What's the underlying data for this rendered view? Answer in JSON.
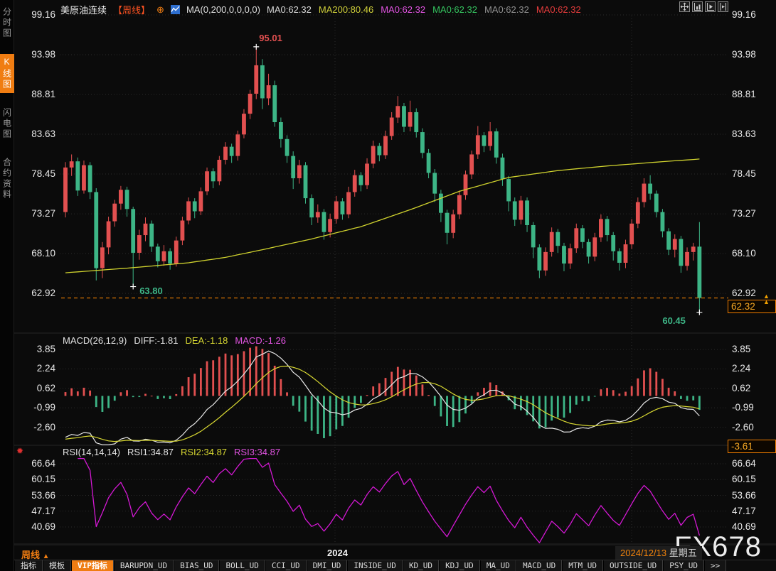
{
  "header": {
    "symbol": "美原油连续",
    "period_tag": "【周线】",
    "link_glyph": "⊕",
    "ma_settings": "MA(0,200,0,0,0,0)",
    "ma_items": [
      {
        "label": "MA0:62.32",
        "color": "#d8d8d8"
      },
      {
        "label": "MA200:80.46",
        "color": "#cfcf3a"
      },
      {
        "label": "MA0:62.32",
        "color": "#e254e2"
      },
      {
        "label": "MA0:62.32",
        "color": "#35c45f"
      },
      {
        "label": "MA0:62.32",
        "color": "#8f8f8f"
      },
      {
        "label": "MA0:62.32",
        "color": "#e23c3c"
      }
    ],
    "toolbar_icons": [
      "pan-icon",
      "axis-compress-icon",
      "axis-play-icon",
      "axis-shift-icon"
    ]
  },
  "sidebar": {
    "items": [
      {
        "label": "分时图",
        "name": "sidebar-item-time-chart",
        "active": false
      },
      {
        "label": "K线图",
        "name": "sidebar-item-kline-chart",
        "active": true
      },
      {
        "label": "闪电图",
        "name": "sidebar-item-flash-chart",
        "active": false
      },
      {
        "label": "合约资料",
        "name": "sidebar-item-contract-info",
        "active": false
      }
    ]
  },
  "macd_panel": {
    "legend": {
      "title": "MACD(26,12,9)",
      "diff": "DIFF:-1.81",
      "dea": "DEA:-1.18",
      "macd": "MACD:-1.26"
    }
  },
  "rsi_panel": {
    "legend": {
      "title": "RSI(14,14,14)",
      "rsi1": "RSI1:34.87",
      "rsi2": "RSI2:34.87",
      "rsi3": "RSI3:34.87"
    }
  },
  "timeline": {
    "period_label": "周线",
    "period_arrow": "▲",
    "year_label": "2024",
    "date": "2024/12/13",
    "weekday": "星期五",
    "watermark": "FX678"
  },
  "tabs": {
    "items": [
      {
        "label": "指标",
        "name": "tab-indicator",
        "active": false
      },
      {
        "label": "模板",
        "name": "tab-template",
        "active": false
      },
      {
        "label": "VIP指标",
        "name": "tab-vip-indicator",
        "active": true
      },
      {
        "label": "BARUPDN_UD",
        "name": "tab-barupdn-ud",
        "active": false
      },
      {
        "label": "BIAS_UD",
        "name": "tab-bias-ud",
        "active": false
      },
      {
        "label": "BOLL_UD",
        "name": "tab-boll-ud",
        "active": false
      },
      {
        "label": "CCI_UD",
        "name": "tab-cci-ud",
        "active": false
      },
      {
        "label": "DMI_UD",
        "name": "tab-dmi-ud",
        "active": false
      },
      {
        "label": "INSIDE_UD",
        "name": "tab-inside-ud",
        "active": false
      },
      {
        "label": "KD_UD",
        "name": "tab-kd-ud",
        "active": false
      },
      {
        "label": "KDJ_UD",
        "name": "tab-kdj-ud",
        "active": false
      },
      {
        "label": "MA_UD",
        "name": "tab-ma-ud",
        "active": false
      },
      {
        "label": "MACD_UD",
        "name": "tab-macd-ud",
        "active": false
      },
      {
        "label": "MTM_UD",
        "name": "tab-mtm-ud",
        "active": false
      },
      {
        "label": "OUTSIDE_UD",
        "name": "tab-outside-ud",
        "active": false
      },
      {
        "label": "PSY_UD",
        "name": "tab-psy-ud",
        "active": false
      },
      {
        "label": ">>",
        "name": "tab-more",
        "active": false
      }
    ]
  },
  "colors": {
    "up": "#e25050",
    "down": "#3db586",
    "ma200": "#cfd22e",
    "dif_line": "#e8e8e8",
    "dea_line": "#d8d832",
    "rsi_line": "#d418d4",
    "accent": "#f07d12",
    "period_tag": "#ff5322",
    "badge_text": "#f5a623",
    "grid": "#2e2e2e",
    "text": "#e8e8e8",
    "annotation_up": "#e25050",
    "annotation_down": "#3db586"
  },
  "chart_data": {
    "type": "candlestick",
    "symbol": "美原油连续",
    "interval": "周线",
    "legend_last": 62.32,
    "last_price": 62.32,
    "price_axis_ticks": [
      99.16,
      93.98,
      88.81,
      83.63,
      78.45,
      73.27,
      68.1,
      62.92
    ],
    "year_dividers_x": [
      471,
      888
    ],
    "annotations": {
      "high": {
        "index": 31,
        "price": 95.01,
        "label": "95.01"
      },
      "low_left": {
        "index": 11,
        "price": 63.8,
        "label": "63.80"
      },
      "low_right": {
        "index": 103,
        "price": 60.45,
        "label": "60.45"
      }
    },
    "ma200": {
      "label": "MA200",
      "last": 80.46,
      "anchors": [
        [
          0,
          65.6
        ],
        [
          10,
          66.2
        ],
        [
          20,
          66.9
        ],
        [
          26,
          67.6
        ],
        [
          32,
          68.6
        ],
        [
          40,
          70.0
        ],
        [
          48,
          71.6
        ],
        [
          56,
          73.8
        ],
        [
          64,
          76.2
        ],
        [
          72,
          78.0
        ],
        [
          80,
          78.9
        ],
        [
          88,
          79.5
        ],
        [
          96,
          80.0
        ],
        [
          103,
          80.4
        ]
      ]
    },
    "macd": {
      "params": [
        26,
        12,
        9
      ],
      "diff": -1.81,
      "dea": -1.18,
      "macd": -1.26,
      "axis_ticks": [
        3.85,
        2.24,
        0.62,
        -0.99,
        -2.6
      ],
      "min_badge": -3.61
    },
    "rsi": {
      "params": [
        14,
        14,
        14
      ],
      "rsi1": 34.87,
      "rsi2": 34.87,
      "rsi3": 34.87,
      "axis_ticks": [
        66.64,
        60.15,
        53.66,
        47.17,
        40.69
      ]
    },
    "candles": [
      [
        73.5,
        80.0,
        72.8,
        79.3
      ],
      [
        79.3,
        81.0,
        78.2,
        80.1
      ],
      [
        80.1,
        80.6,
        75.6,
        76.3
      ],
      [
        76.3,
        80.2,
        75.9,
        79.6
      ],
      [
        79.6,
        80.0,
        75.2,
        76.1
      ],
      [
        76.1,
        76.6,
        64.6,
        66.2
      ],
      [
        66.2,
        69.6,
        64.9,
        68.9
      ],
      [
        68.9,
        72.9,
        68.0,
        72.3
      ],
      [
        72.3,
        75.1,
        71.6,
        74.6
      ],
      [
        74.6,
        76.9,
        73.8,
        76.4
      ],
      [
        76.4,
        76.8,
        72.9,
        73.9
      ],
      [
        73.9,
        74.2,
        63.8,
        68.2
      ],
      [
        68.2,
        71.2,
        67.3,
        70.5
      ],
      [
        70.5,
        72.8,
        69.7,
        72.0
      ],
      [
        72.0,
        72.4,
        68.3,
        69.0
      ],
      [
        69.0,
        69.4,
        66.3,
        67.1
      ],
      [
        67.1,
        69.2,
        66.5,
        68.4
      ],
      [
        68.4,
        68.8,
        66.0,
        66.8
      ],
      [
        66.8,
        70.3,
        66.4,
        69.8
      ],
      [
        69.8,
        72.9,
        69.2,
        72.4
      ],
      [
        72.4,
        75.4,
        71.9,
        74.9
      ],
      [
        74.9,
        75.3,
        72.7,
        73.6
      ],
      [
        73.6,
        76.7,
        73.1,
        76.2
      ],
      [
        76.2,
        79.3,
        75.7,
        78.8
      ],
      [
        78.8,
        79.2,
        76.6,
        77.5
      ],
      [
        77.5,
        80.8,
        77.0,
        80.3
      ],
      [
        80.3,
        82.6,
        79.7,
        82.0
      ],
      [
        82.0,
        82.4,
        79.9,
        80.8
      ],
      [
        80.8,
        84.1,
        80.2,
        83.6
      ],
      [
        83.6,
        86.9,
        83.1,
        86.3
      ],
      [
        86.3,
        89.4,
        85.6,
        88.9
      ],
      [
        88.9,
        95.01,
        88.2,
        92.6
      ],
      [
        92.6,
        93.4,
        86.9,
        88.3
      ],
      [
        88.3,
        91.5,
        87.4,
        90.0
      ],
      [
        90.0,
        90.6,
        84.6,
        85.2
      ],
      [
        85.2,
        85.8,
        81.9,
        83.0
      ],
      [
        83.0,
        83.5,
        79.9,
        80.8
      ],
      [
        80.8,
        81.4,
        76.5,
        77.9
      ],
      [
        77.9,
        80.3,
        77.2,
        79.6
      ],
      [
        79.6,
        80.0,
        74.6,
        75.3
      ],
      [
        75.3,
        75.8,
        71.8,
        72.8
      ],
      [
        72.8,
        74.5,
        72.1,
        73.5
      ],
      [
        73.5,
        73.9,
        69.9,
        70.9
      ],
      [
        70.9,
        73.3,
        70.2,
        72.6
      ],
      [
        72.6,
        75.6,
        72.0,
        74.9
      ],
      [
        74.9,
        75.3,
        72.5,
        73.2
      ],
      [
        73.2,
        76.8,
        72.7,
        76.1
      ],
      [
        76.1,
        79.0,
        75.5,
        78.3
      ],
      [
        78.3,
        78.7,
        76.2,
        77.0
      ],
      [
        77.0,
        80.5,
        76.5,
        79.8
      ],
      [
        79.8,
        82.8,
        79.2,
        82.1
      ],
      [
        82.1,
        82.5,
        80.1,
        80.9
      ],
      [
        80.9,
        84.1,
        80.4,
        83.4
      ],
      [
        83.4,
        86.5,
        82.9,
        85.8
      ],
      [
        85.8,
        88.6,
        85.1,
        87.3
      ],
      [
        87.3,
        87.7,
        83.9,
        84.6
      ],
      [
        84.6,
        88.0,
        84.0,
        86.5
      ],
      [
        86.5,
        87.0,
        83.2,
        83.9
      ],
      [
        83.9,
        84.4,
        80.5,
        81.2
      ],
      [
        81.2,
        81.7,
        77.9,
        78.6
      ],
      [
        78.6,
        79.1,
        74.8,
        75.9
      ],
      [
        75.9,
        76.4,
        72.2,
        73.4
      ],
      [
        73.4,
        73.8,
        69.3,
        70.8
      ],
      [
        70.8,
        73.8,
        70.1,
        73.2
      ],
      [
        73.2,
        76.3,
        72.6,
        75.7
      ],
      [
        75.7,
        78.9,
        75.1,
        78.4
      ],
      [
        78.4,
        81.5,
        77.8,
        81.0
      ],
      [
        81.0,
        84.7,
        80.4,
        83.5
      ],
      [
        83.5,
        83.9,
        81.3,
        82.1
      ],
      [
        82.1,
        85.2,
        81.5,
        84.0
      ],
      [
        84.0,
        84.4,
        79.8,
        80.6
      ],
      [
        80.6,
        81.1,
        76.9,
        77.8
      ],
      [
        77.8,
        78.2,
        73.6,
        74.9
      ],
      [
        74.9,
        75.4,
        71.7,
        72.5
      ],
      [
        72.5,
        75.6,
        71.9,
        75.0
      ],
      [
        75.0,
        75.4,
        70.9,
        71.8
      ],
      [
        71.8,
        72.2,
        67.5,
        68.9
      ],
      [
        68.9,
        69.3,
        64.9,
        65.9
      ],
      [
        65.9,
        68.9,
        65.2,
        68.3
      ],
      [
        68.3,
        71.5,
        67.7,
        70.9
      ],
      [
        70.9,
        71.3,
        68.2,
        69.1
      ],
      [
        69.1,
        69.5,
        65.8,
        66.8
      ],
      [
        66.8,
        69.4,
        66.1,
        68.8
      ],
      [
        68.8,
        72.0,
        68.2,
        71.4
      ],
      [
        71.4,
        71.8,
        68.8,
        69.6
      ],
      [
        69.6,
        70.0,
        66.8,
        67.7
      ],
      [
        67.7,
        70.8,
        67.1,
        70.2
      ],
      [
        70.2,
        73.2,
        69.6,
        72.6
      ],
      [
        72.6,
        73.0,
        69.7,
        70.5
      ],
      [
        70.5,
        70.9,
        67.2,
        68.4
      ],
      [
        68.4,
        68.8,
        65.9,
        66.9
      ],
      [
        66.9,
        69.9,
        66.2,
        69.3
      ],
      [
        69.3,
        72.6,
        68.7,
        72.0
      ],
      [
        72.0,
        75.4,
        71.4,
        74.8
      ],
      [
        74.8,
        77.9,
        74.1,
        77.2
      ],
      [
        77.2,
        78.3,
        75.1,
        75.9
      ],
      [
        75.9,
        76.3,
        72.8,
        73.5
      ],
      [
        73.5,
        73.9,
        70.2,
        71.0
      ],
      [
        71.0,
        71.4,
        67.9,
        68.6
      ],
      [
        68.6,
        70.6,
        67.6,
        70.0
      ],
      [
        70.0,
        70.4,
        65.6,
        66.5
      ],
      [
        66.5,
        68.9,
        65.9,
        68.3
      ],
      [
        68.3,
        69.5,
        67.2,
        69.0
      ],
      [
        69.0,
        72.2,
        60.45,
        62.32
      ]
    ]
  }
}
